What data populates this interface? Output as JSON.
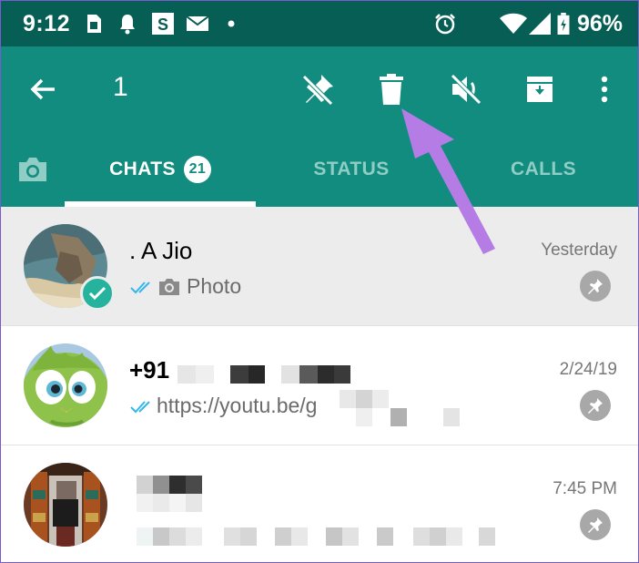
{
  "status_bar": {
    "time": "9:12",
    "battery_percent": "96%",
    "icons": [
      "sim-card-icon",
      "notification-bell-icon",
      "app-s-icon",
      "mail-icon",
      "dot-icon",
      "alarm-icon",
      "wifi-icon",
      "signal-icon",
      "battery-charging-icon"
    ]
  },
  "toolbar": {
    "selected_count": "1",
    "actions": [
      "back-arrow-icon",
      "unpin-icon",
      "delete-icon",
      "mute-icon",
      "archive-icon",
      "more-options-icon"
    ]
  },
  "tabs": [
    {
      "label": "",
      "icon": "camera-icon"
    },
    {
      "label": "CHATS",
      "badge": "21",
      "active": true
    },
    {
      "label": "STATUS"
    },
    {
      "label": "CALLS"
    }
  ],
  "chats": [
    {
      "name": ". A Jio",
      "time": "Yesterday",
      "preview": "Photo",
      "read": true,
      "media": "camera-icon",
      "pinned": true,
      "selected": true
    },
    {
      "name": "+91",
      "time": "2/24/19",
      "preview": "https://youtu.be/g",
      "read": true,
      "pinned": true,
      "selected": false
    },
    {
      "name": "",
      "time": "7:45 PM",
      "preview": "",
      "pinned": true,
      "selected": false
    }
  ],
  "colors": {
    "status_bar": "#075e54",
    "toolbar": "#128c7e",
    "inactive_tab": "#8fcdc5",
    "selected_row": "#ececec",
    "read_ticks": "#34b7f1",
    "check_badge": "#25b39e",
    "annotation_arrow": "#b57ce6"
  }
}
